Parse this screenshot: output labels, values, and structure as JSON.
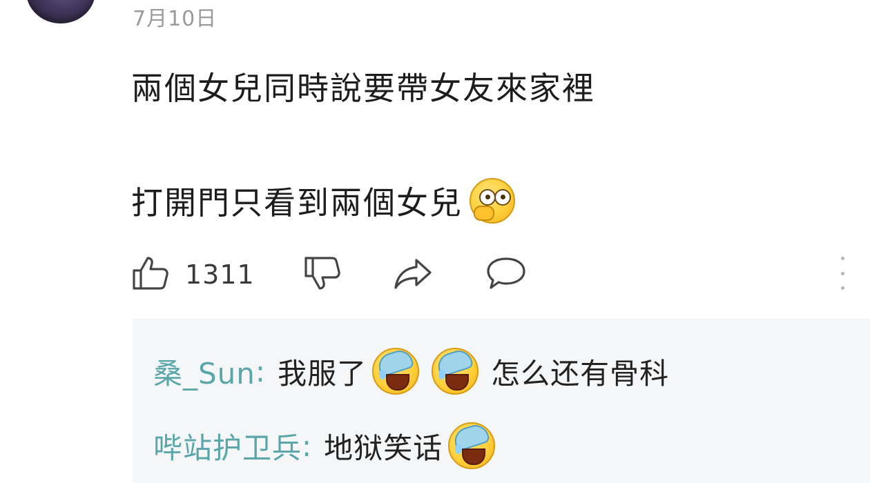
{
  "comment": {
    "date": "7月10日",
    "line1": "兩個女兒同時說要帶女友來家裡",
    "line2": "打開門只看到兩個女兒",
    "line2_emoji": "thinking-peek-emoji"
  },
  "actions": {
    "like_icon": "thumbs-up-icon",
    "like_count": "1311",
    "dislike_icon": "thumbs-down-icon",
    "share_icon": "share-arrow-icon",
    "reply_icon": "comment-bubble-icon",
    "more_icon": "vertical-dots-icon"
  },
  "replies": [
    {
      "user": "桑_Sun",
      "separator": ":",
      "text_before": "我服了",
      "emojis": [
        "facepalm-laugh-emoji",
        "facepalm-laugh-emoji"
      ],
      "text_after": "怎么还有骨科"
    },
    {
      "user": "哔站护卫兵",
      "separator": ":",
      "text_before": "地狱笑话",
      "emojis": [
        "facepalm-laugh-emoji"
      ],
      "text_after": ""
    }
  ],
  "colors": {
    "username": "#5aa6a9",
    "reply_background": "#f4f6f8",
    "date": "#9a9a9a",
    "icon_stroke": "#444444"
  }
}
